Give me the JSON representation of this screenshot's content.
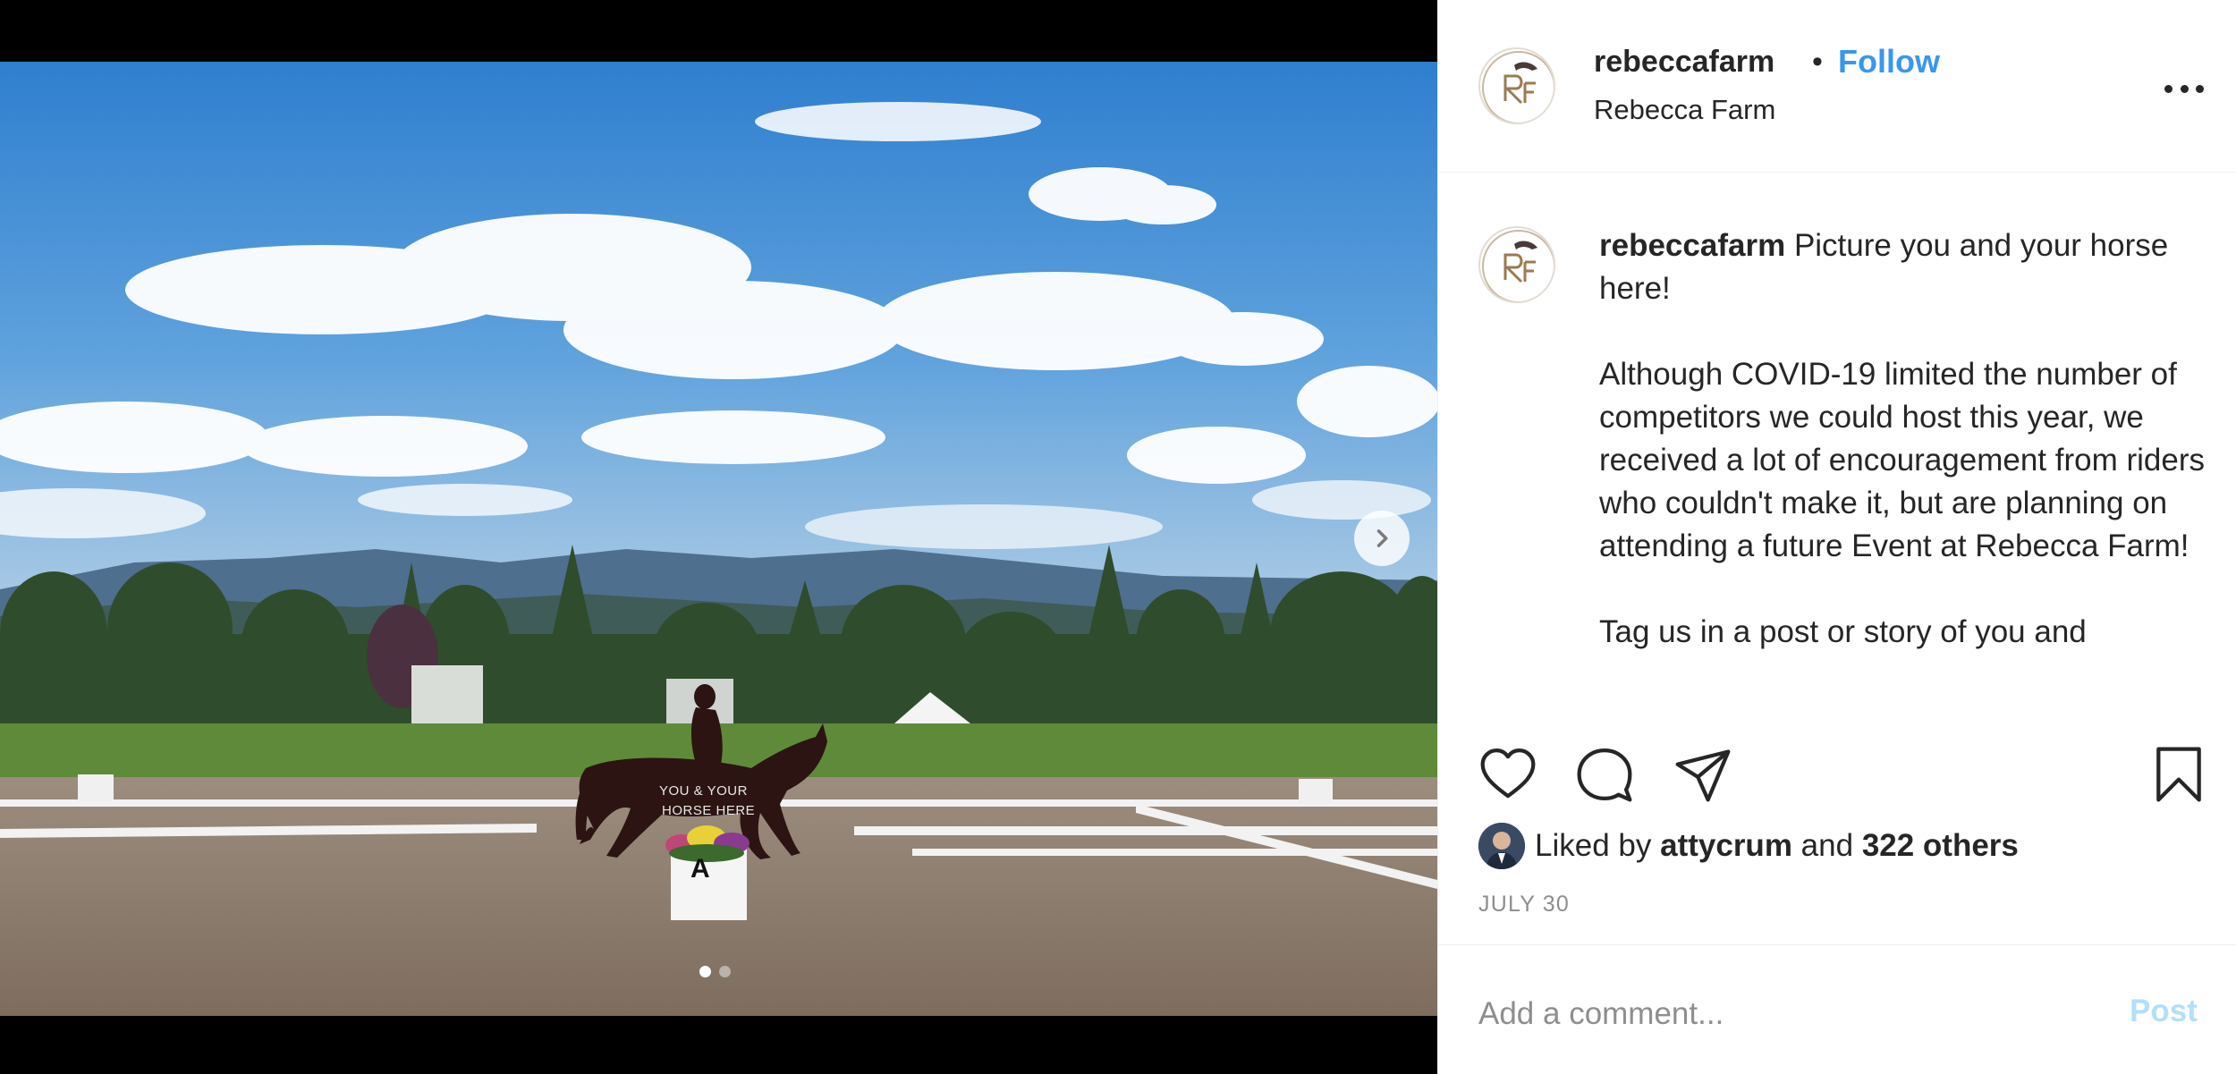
{
  "photo": {
    "overlay_line1": "YOU & YOUR",
    "overlay_line2": "HORSE HERE",
    "marker_letter": "A",
    "carousel_total": 2,
    "carousel_active": 1
  },
  "header": {
    "username": "rebeccafarm",
    "separator": "•",
    "follow_label": "Follow",
    "location": "Rebecca Farm"
  },
  "caption": {
    "username": "rebeccafarm",
    "text": "Picture you and your horse here!\n\nAlthough COVID-19 limited the number of competitors we could host this year, we received a lot of encouragement from riders who couldn't make it, but are planning on attending a future Event at Rebecca Farm!\n\nTag us in a post or story of you and"
  },
  "likes": {
    "prefix": "Liked by",
    "first_liker": "attycrum",
    "joiner": "and",
    "others": "322 others"
  },
  "post_date": "JULY 30",
  "comment": {
    "placeholder": "Add a comment...",
    "post_label": "Post"
  },
  "colors": {
    "follow_blue": "#3897f0",
    "post_disabled_blue": "#b2dffc",
    "muted_gray": "#8e8e8e",
    "text_dark": "#262626"
  },
  "icons": [
    "chevron-right-icon",
    "more-options-icon",
    "heart-icon",
    "comment-bubble-icon",
    "paper-plane-icon",
    "bookmark-icon"
  ]
}
